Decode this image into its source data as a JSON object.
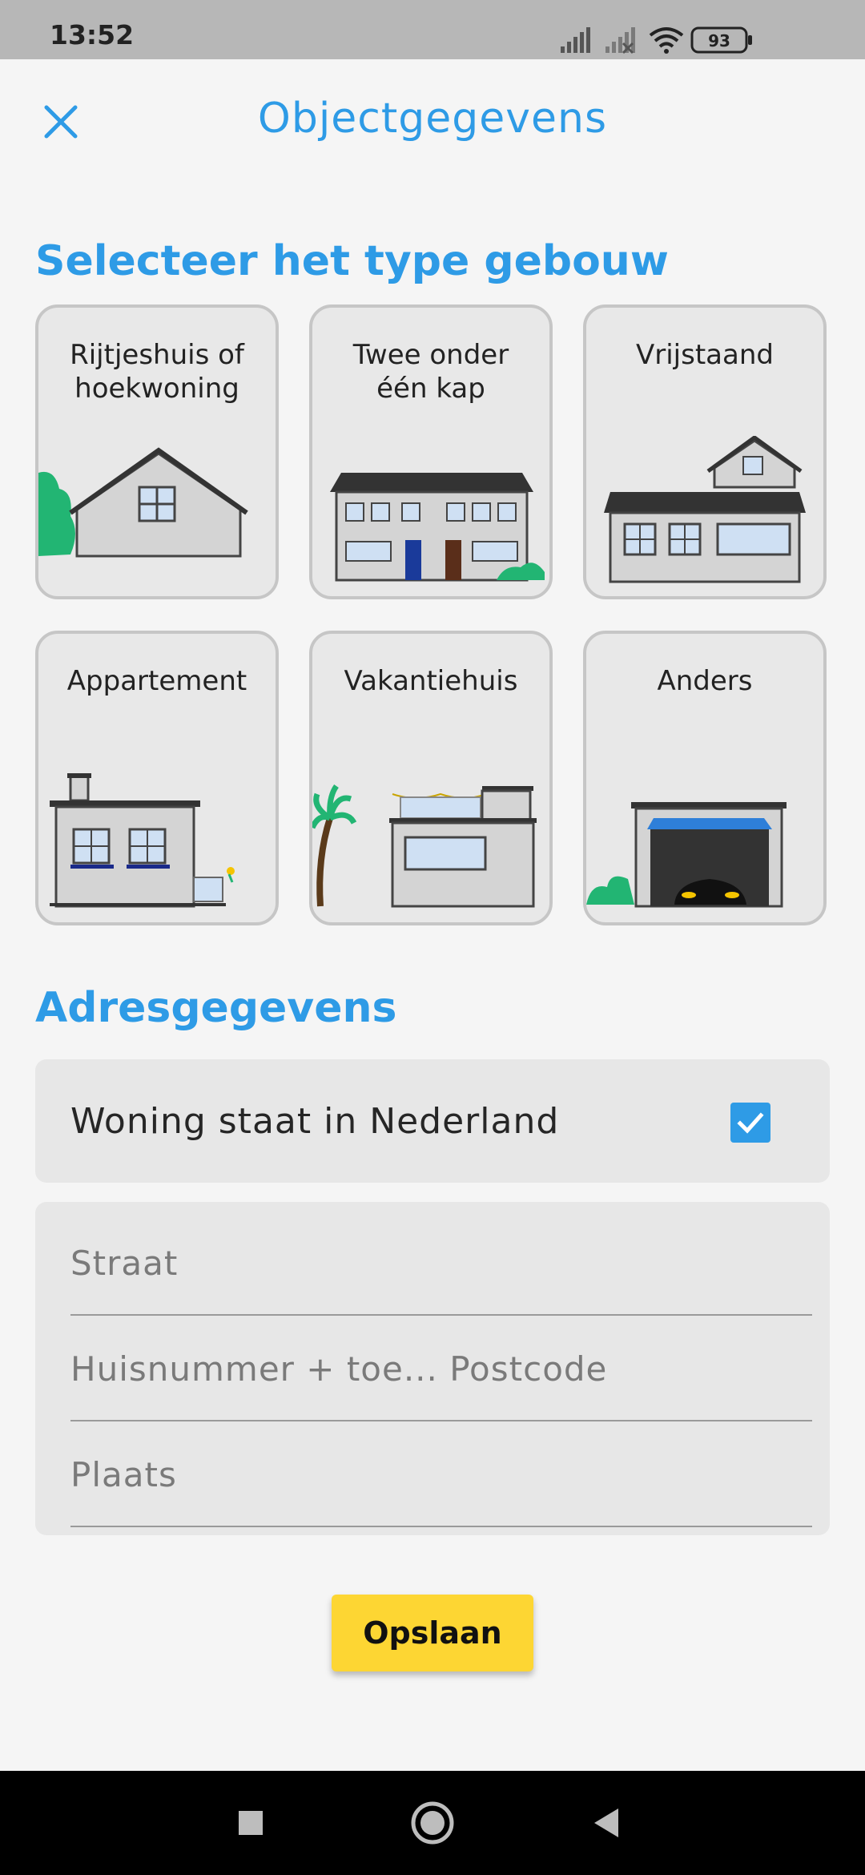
{
  "status_bar": {
    "time": "13:52",
    "battery": "93",
    "icons": [
      "signal-icon",
      "signal-no-sim-icon",
      "wifi-icon",
      "battery-icon"
    ]
  },
  "header": {
    "title": "Objectgegevens",
    "close_icon": "close-icon"
  },
  "building_section": {
    "title": "Selecteer het type gebouw",
    "types": [
      {
        "label": "Rijtjeshuis of\nhoekwoning"
      },
      {
        "label": "Twee onder\néén kap"
      },
      {
        "label": "Vrijstaand"
      },
      {
        "label": "Appartement"
      },
      {
        "label": "Vakantiehuis"
      },
      {
        "label": "Anders"
      }
    ]
  },
  "address_section": {
    "title": "Adresgegevens",
    "in_netherlands": {
      "label": "Woning staat in Nederland",
      "checked": true
    },
    "fields": {
      "street": {
        "placeholder": "Straat",
        "value": ""
      },
      "house_postcode": {
        "placeholder": "Huisnummer + toe... Postcode",
        "value": ""
      },
      "city": {
        "placeholder": "Plaats",
        "value": ""
      }
    }
  },
  "save_label": "Opslaan",
  "colors": {
    "accent": "#2e9be6",
    "button": "#fdd633",
    "card_bg": "#e8e8e8"
  }
}
